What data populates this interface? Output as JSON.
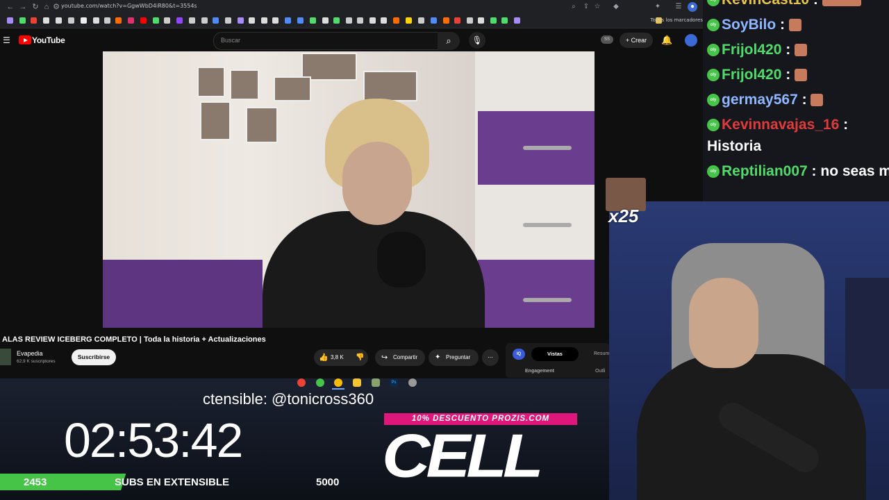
{
  "browser": {
    "url": "youtube.com/watch?v=GgwWbD4iR80&t=3554s",
    "bookmarks_all": "Todos los marcadores"
  },
  "youtube": {
    "logo_text": "YouTube",
    "search_placeholder": "Buscar",
    "ss_badge": "SS",
    "create_label": "Crear"
  },
  "video": {
    "title": "ALAS REVIEW ICEBERG COMPLETO | Toda la historia + Actualizaciones",
    "channel": "Evapedia",
    "subscribers": "62,9 K suscriptores",
    "subscribe_label": "Suscribirse",
    "likes": "3,8 K",
    "share_label": "Compartir",
    "ask_label": "Preguntar"
  },
  "sidepanel": {
    "iq": "IQ",
    "tab_active": "Vistas",
    "tab_other": "Resum",
    "engagement": "Engagement",
    "outlier": "Outli"
  },
  "overlay": {
    "ticker": "ctensible: @tonicross360",
    "timer": "02:53:42",
    "progress_current": "2453",
    "progress_label": "SUBS EN EXTENSIBLE",
    "progress_goal": "5000",
    "progress_fraction": 0.49,
    "promo": "10% DESCUENTO PROZIS.COM",
    "brand": "CELL",
    "emote_count": "x25"
  },
  "chat": {
    "messages": [
      {
        "user": "KevinCast10",
        "color": "#e6c34a",
        "text": "",
        "emote": true
      },
      {
        "user": "SoyBilo",
        "color": "#8fb7ff",
        "text": "",
        "emote": true
      },
      {
        "user": "Frijol420",
        "color": "#4fdc6a",
        "text": "",
        "emote": true
      },
      {
        "user": "Frijol420",
        "color": "#4fdc6a",
        "text": "",
        "emote": true
      },
      {
        "user": "germay567",
        "color": "#8fb7ff",
        "text": "",
        "emote": true
      },
      {
        "user": "Kevinnavajas_16",
        "color": "#e03b3b",
        "text": "Historia",
        "emote": false
      },
      {
        "user": "Reptilian007",
        "color": "#4fdc6a",
        "text": "no seas malo",
        "emote": false
      }
    ]
  },
  "colors": {
    "accent_green": "#45c447",
    "promo_pink": "#e0177a",
    "yt_red": "#ff0000"
  }
}
